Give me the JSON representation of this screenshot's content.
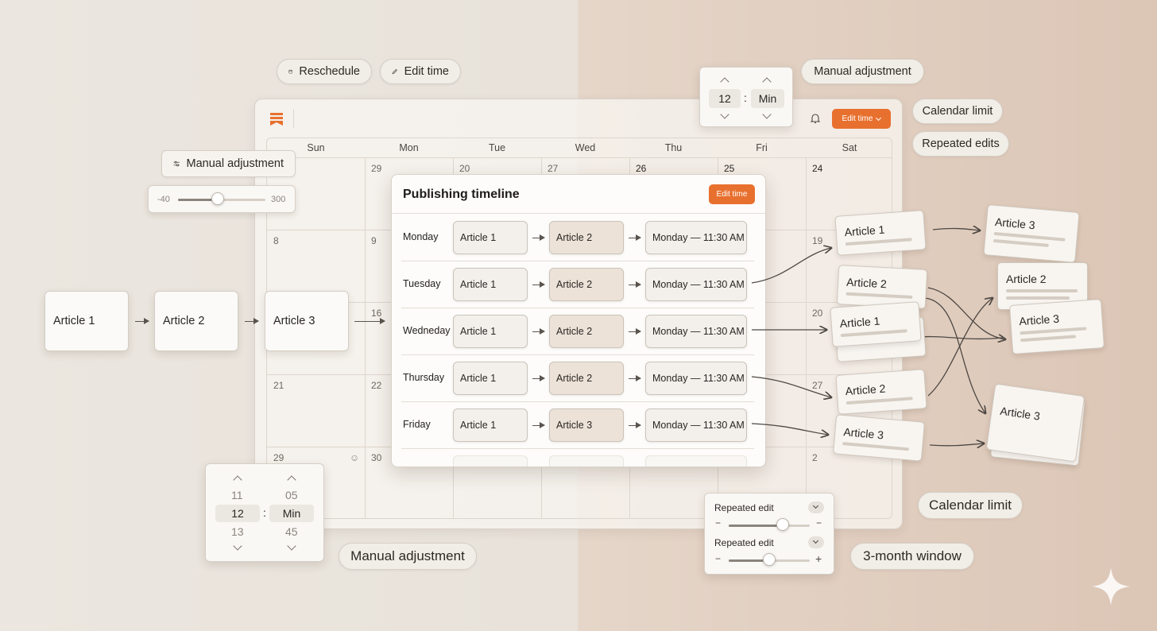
{
  "top_pills": {
    "reschedule": "Reschedule",
    "edit_time": "Edit time",
    "manual_adjustment": "Manual adjustment"
  },
  "side_pills": {
    "calendar_limit": "Calendar limit",
    "repeated_edits": "Repeated edits"
  },
  "bottom_pills": {
    "manual_adjustment": "Manual adjustment",
    "calendar_limit": "Calendar limit",
    "three_month": "3-month window"
  },
  "flow_left": [
    "Article 1",
    "Article 2",
    "Article 3"
  ],
  "slider_popup": {
    "label": "Manual adjustment",
    "min": "-40",
    "max": "300",
    "value_fraction": 0.45
  },
  "calendar": {
    "edit_time": "Edit time",
    "days": [
      "Sun",
      "Mon",
      "Tue",
      "Wed",
      "Thu",
      "Fri",
      "Sat"
    ],
    "numbers": {
      "r1": [
        "",
        "29",
        "20",
        "27",
        "26",
        "25",
        "24"
      ],
      "r2": [
        "8",
        "9",
        "",
        "",
        "",
        "",
        "19"
      ],
      "r3": [
        "",
        "16",
        "",
        "",
        "",
        "",
        "20"
      ],
      "r4": [
        "21",
        "22",
        "",
        "",
        "",
        "",
        "27"
      ],
      "r5": [
        "29",
        "30",
        "",
        "",
        "",
        "",
        "2"
      ]
    }
  },
  "top_picker": {
    "hour": "12",
    "minute": "Min",
    "sep": ":"
  },
  "timeline": {
    "title": "Publishing timeline",
    "button": "Edit time",
    "rows": [
      {
        "day": "Monday",
        "a": "Article 1",
        "b": "Article 2",
        "c": "Monday — 11:30 AM"
      },
      {
        "day": "Tuesday",
        "a": "Article 1",
        "b": "Article 2",
        "c": "Monday — 11:30 AM"
      },
      {
        "day": "Wedneday",
        "a": "Article 1",
        "b": "Article 2",
        "c": "Monday — 11:30 AM"
      },
      {
        "day": "Thursday",
        "a": "Article 1",
        "b": "Article 2",
        "c": "Monday — 11:30 AM"
      },
      {
        "day": "Friday",
        "a": "Article 1",
        "b": "Article 3",
        "c": "Monday — 11:30 AM"
      }
    ]
  },
  "right_cards": {
    "c1": "Article 1",
    "c2": "Article 2",
    "c3": "Article 1",
    "c4": "Article 2",
    "c5": "Article 3",
    "d1": "Article 3",
    "d2": "Article 2",
    "d3": "Article 3",
    "d4": "Article 3"
  },
  "bottom_picker": {
    "h_prev": "11",
    "h_cur": "12",
    "h_next": "13",
    "m_prev": "05",
    "m_cur": "Min",
    "m_next": "45",
    "sep": ":"
  },
  "repeat_panel": {
    "label1": "Repeated edit",
    "label2": "Repeated edit",
    "value1": 0.67,
    "value2": 0.5
  }
}
